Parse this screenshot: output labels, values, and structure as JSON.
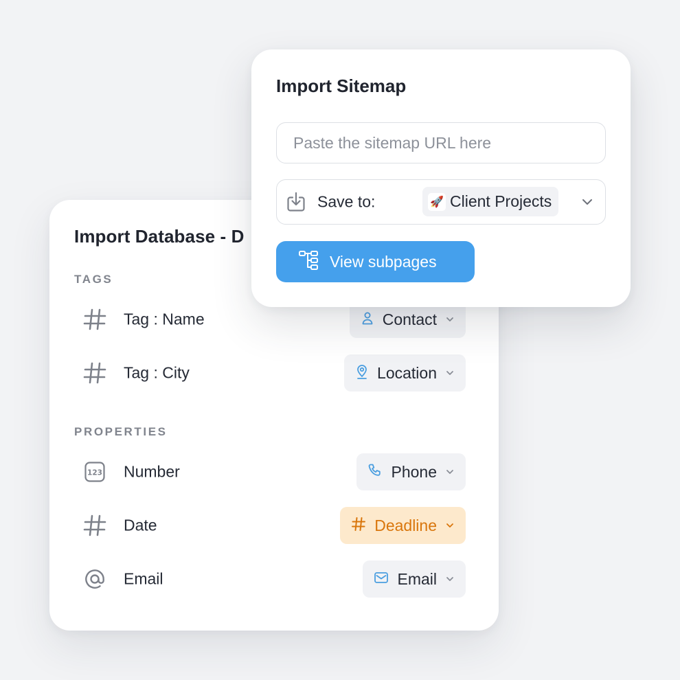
{
  "sitemap": {
    "title": "Import Sitemap",
    "url_placeholder": "Paste the sitemap URL here",
    "save_label": "Save to:",
    "destination_icon": "rocket-icon",
    "destination": "Client Projects",
    "view_button": "View subpages"
  },
  "database": {
    "title": "Import Database - D",
    "tags_label": "TAGS",
    "properties_label": "PROPERTIES",
    "tags": [
      {
        "label": "Tag : Name",
        "icon": "hash-icon",
        "type": "Contact",
        "type_icon": "user-icon"
      },
      {
        "label": "Tag : City",
        "icon": "hash-icon",
        "type": "Location",
        "type_icon": "location-pin-icon"
      }
    ],
    "properties": [
      {
        "label": "Number",
        "icon": "number-123-icon",
        "type": "Phone",
        "type_icon": "phone-icon"
      },
      {
        "label": "Date",
        "icon": "hash-icon",
        "type": "Deadline",
        "type_icon": "hash-icon"
      },
      {
        "label": "Email",
        "icon": "at-sign-icon",
        "type": "Email",
        "type_icon": "mail-icon"
      }
    ]
  },
  "colors": {
    "background": "#f2f3f5",
    "primary_button": "#45a0ec",
    "icon_blue": "#4a9ee0",
    "warning_bg": "#fde9cc",
    "warning_text": "#d9760c",
    "pill_bg": "#f1f2f5"
  }
}
